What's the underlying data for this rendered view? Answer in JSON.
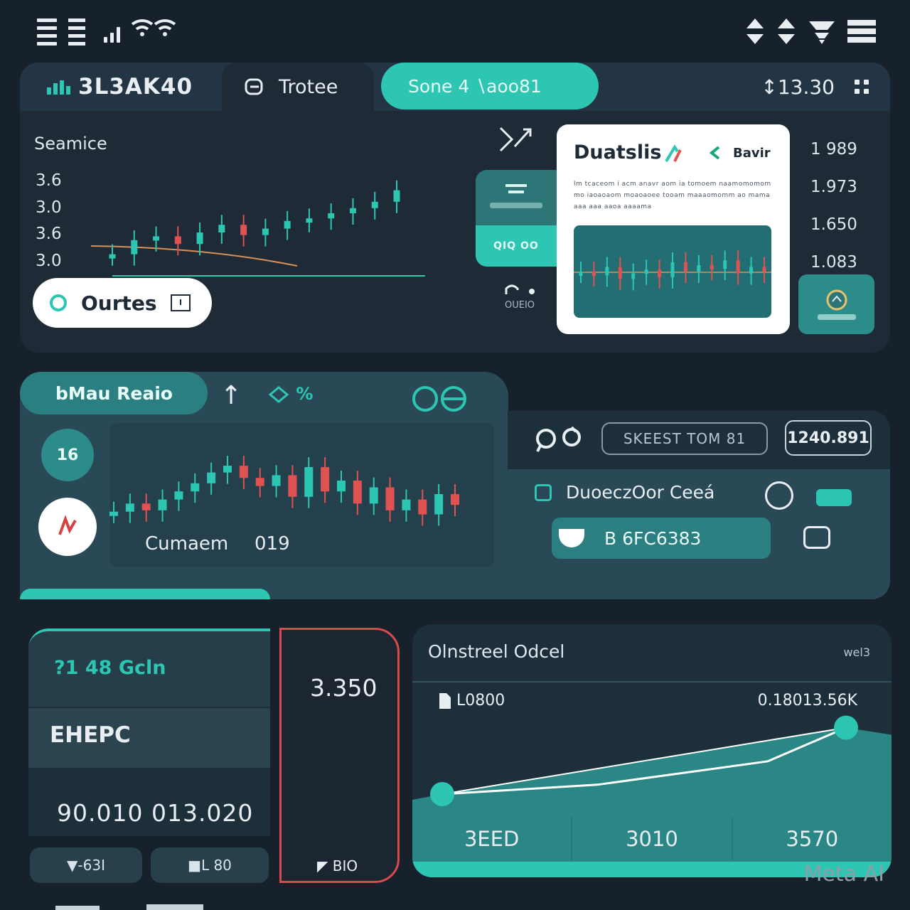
{
  "status_bar": {
    "left_icons": [
      "menu-icon",
      "signal-icon",
      "wifi-icon"
    ],
    "right_icons": [
      "sort-icon",
      "sort-icon",
      "filter-icon",
      "menu-icon"
    ]
  },
  "header": {
    "ticker": "3L3AK40",
    "trade_tab": "Trotee",
    "active_pill": "Sone 4 ∖aoo81",
    "balance": "↕13.30"
  },
  "main_chart": {
    "label": "Seamice",
    "y_ticks": [
      "3.6",
      "3.0",
      "3.6",
      "3.0"
    ],
    "orders_button": "Ourtes"
  },
  "side_card": {
    "bottom_label": "QIQ OO",
    "under_label": "OUEIO"
  },
  "analysis_card": {
    "title": "Duatslis",
    "tag": "Bavir",
    "text": "lm tcaceom i acm anavr aom ia tomoem naamomomom mo iaoaoaom moaoaoee tooam maaaomomm ao mama aaa aaa aaoa aaaama"
  },
  "price_column": [
    "1 989",
    "1.973",
    "1.650",
    "1.083"
  ],
  "secondary_panel": {
    "tab_label": "bMau Reaio",
    "percent_text": "%",
    "avatar_text": "16",
    "current_label": "Cumaem",
    "current_value": "019",
    "search_text": "SKEEST TOM 81",
    "value_box": "1240.891",
    "doc_label": "DuoeczOor Ceeá",
    "input_value": "B 6FC6383"
  },
  "gain_card": {
    "gain_label": "?1 48 Gcln",
    "name": "EHEPC",
    "big_number": "90.010 013.020",
    "chip1": "▼-63I",
    "chip2": "■L 80"
  },
  "red_card": {
    "value": "3.350",
    "foot": "◤ BIO"
  },
  "order_card": {
    "title": "Olnstreel Odcel",
    "tag": "wel3",
    "row_left": "L0800",
    "row_right": "0.18013.56K",
    "footer": [
      "3EED",
      "3010",
      "3570"
    ]
  },
  "chart_data": [
    {
      "type": "line",
      "title": "Seamice",
      "y_ticks": [
        "3.6",
        "3.0",
        "3.6",
        "3.0"
      ],
      "series": [
        {
          "values": [
            0.72,
            0.61,
            0.58,
            0.64,
            0.55,
            0.49,
            0.57,
            0.52,
            0.46,
            0.44,
            0.4,
            0.36,
            0.31,
            0.22
          ]
        }
      ]
    },
    {
      "type": "line",
      "series": [
        {
          "values": [
            0.37,
            0.43,
            0.38,
            0.46,
            0.52,
            0.58,
            0.66,
            0.71,
            0.62,
            0.56
          ]
        }
      ]
    },
    {
      "type": "line",
      "x": [
        "3EED",
        "3010",
        "3570"
      ],
      "series": [
        {
          "values": [
            0.1,
            0.22,
            0.52,
            0.95
          ]
        }
      ]
    }
  ],
  "colors": {
    "background": "#17212b",
    "accent": "#2cc6b3",
    "panel": "#1e2a36",
    "bull": "#2cc6b3",
    "bear": "#e05252"
  },
  "watermark": "Meta AI"
}
